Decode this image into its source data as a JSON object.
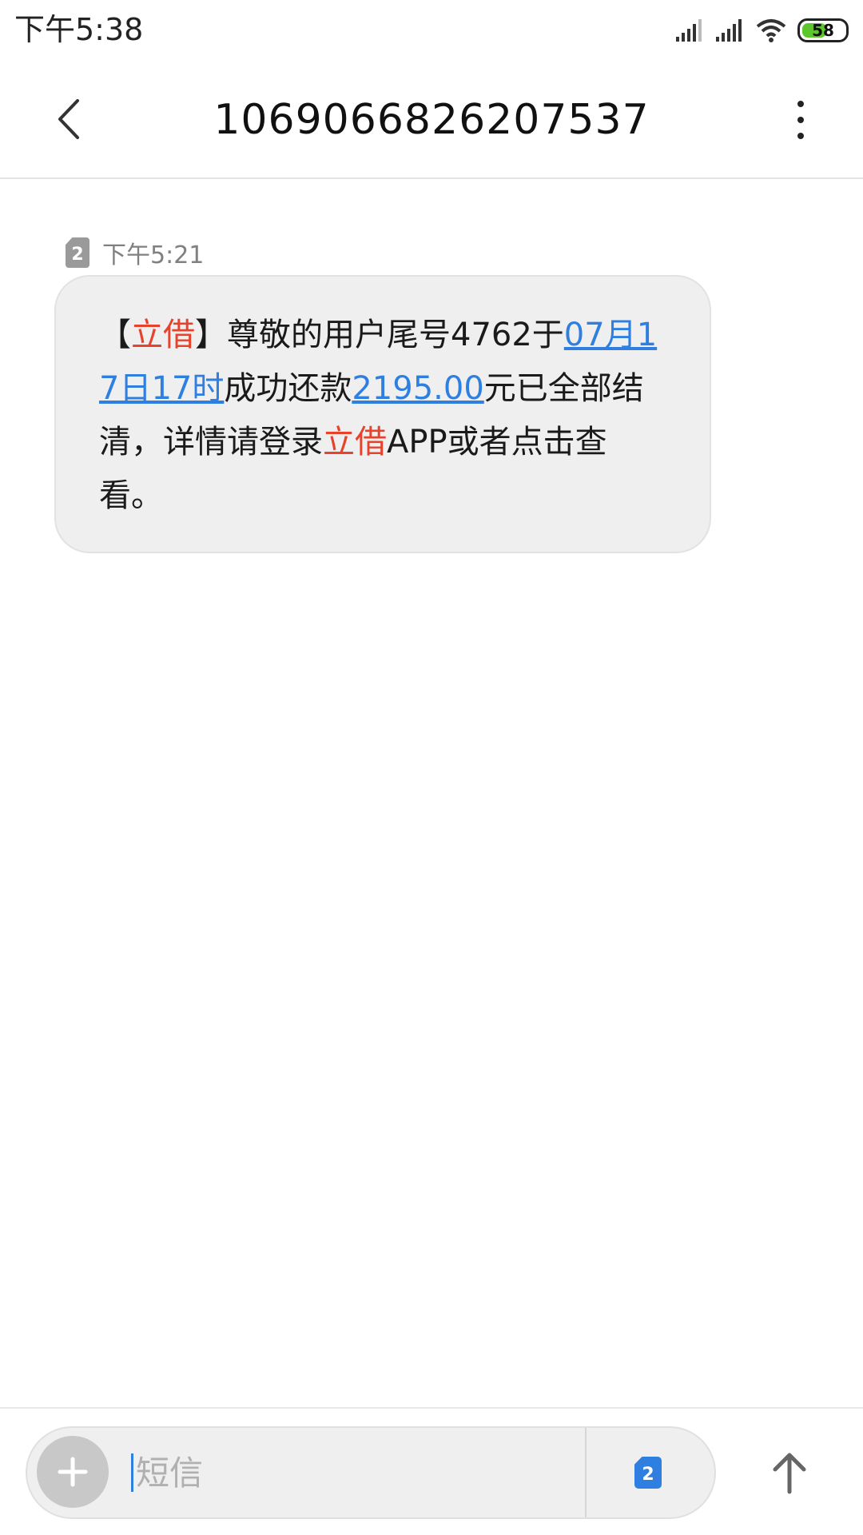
{
  "status_bar": {
    "time": "下午5:38",
    "battery_level": "58",
    "battery_fraction": 0.58,
    "battery_color": "#5cc62b"
  },
  "header": {
    "title": "1069066826207537",
    "back_icon": "chevron-left-icon",
    "more_icon": "more-vertical-icon"
  },
  "message": {
    "sim": "2",
    "time": "下午5:21",
    "parts": {
      "bracket_open": "【",
      "sender_name": "立借",
      "bracket_close": "】",
      "text_1": "尊敬的用户尾号4762于",
      "date_link": "07月17日17时",
      "text_2": "成功还款",
      "amount_link": "2195.00",
      "text_3": "元已全部结清，详情请登录",
      "app_name": "立借",
      "text_4": "APP或者点击查看。"
    }
  },
  "composer": {
    "placeholder": "短信",
    "sim": "2",
    "add_icon": "plus-icon",
    "send_icon": "arrow-up-icon"
  },
  "colors": {
    "accent": "#2f7fe0",
    "highlight": "#e5432c",
    "bubble": "#efefef"
  }
}
